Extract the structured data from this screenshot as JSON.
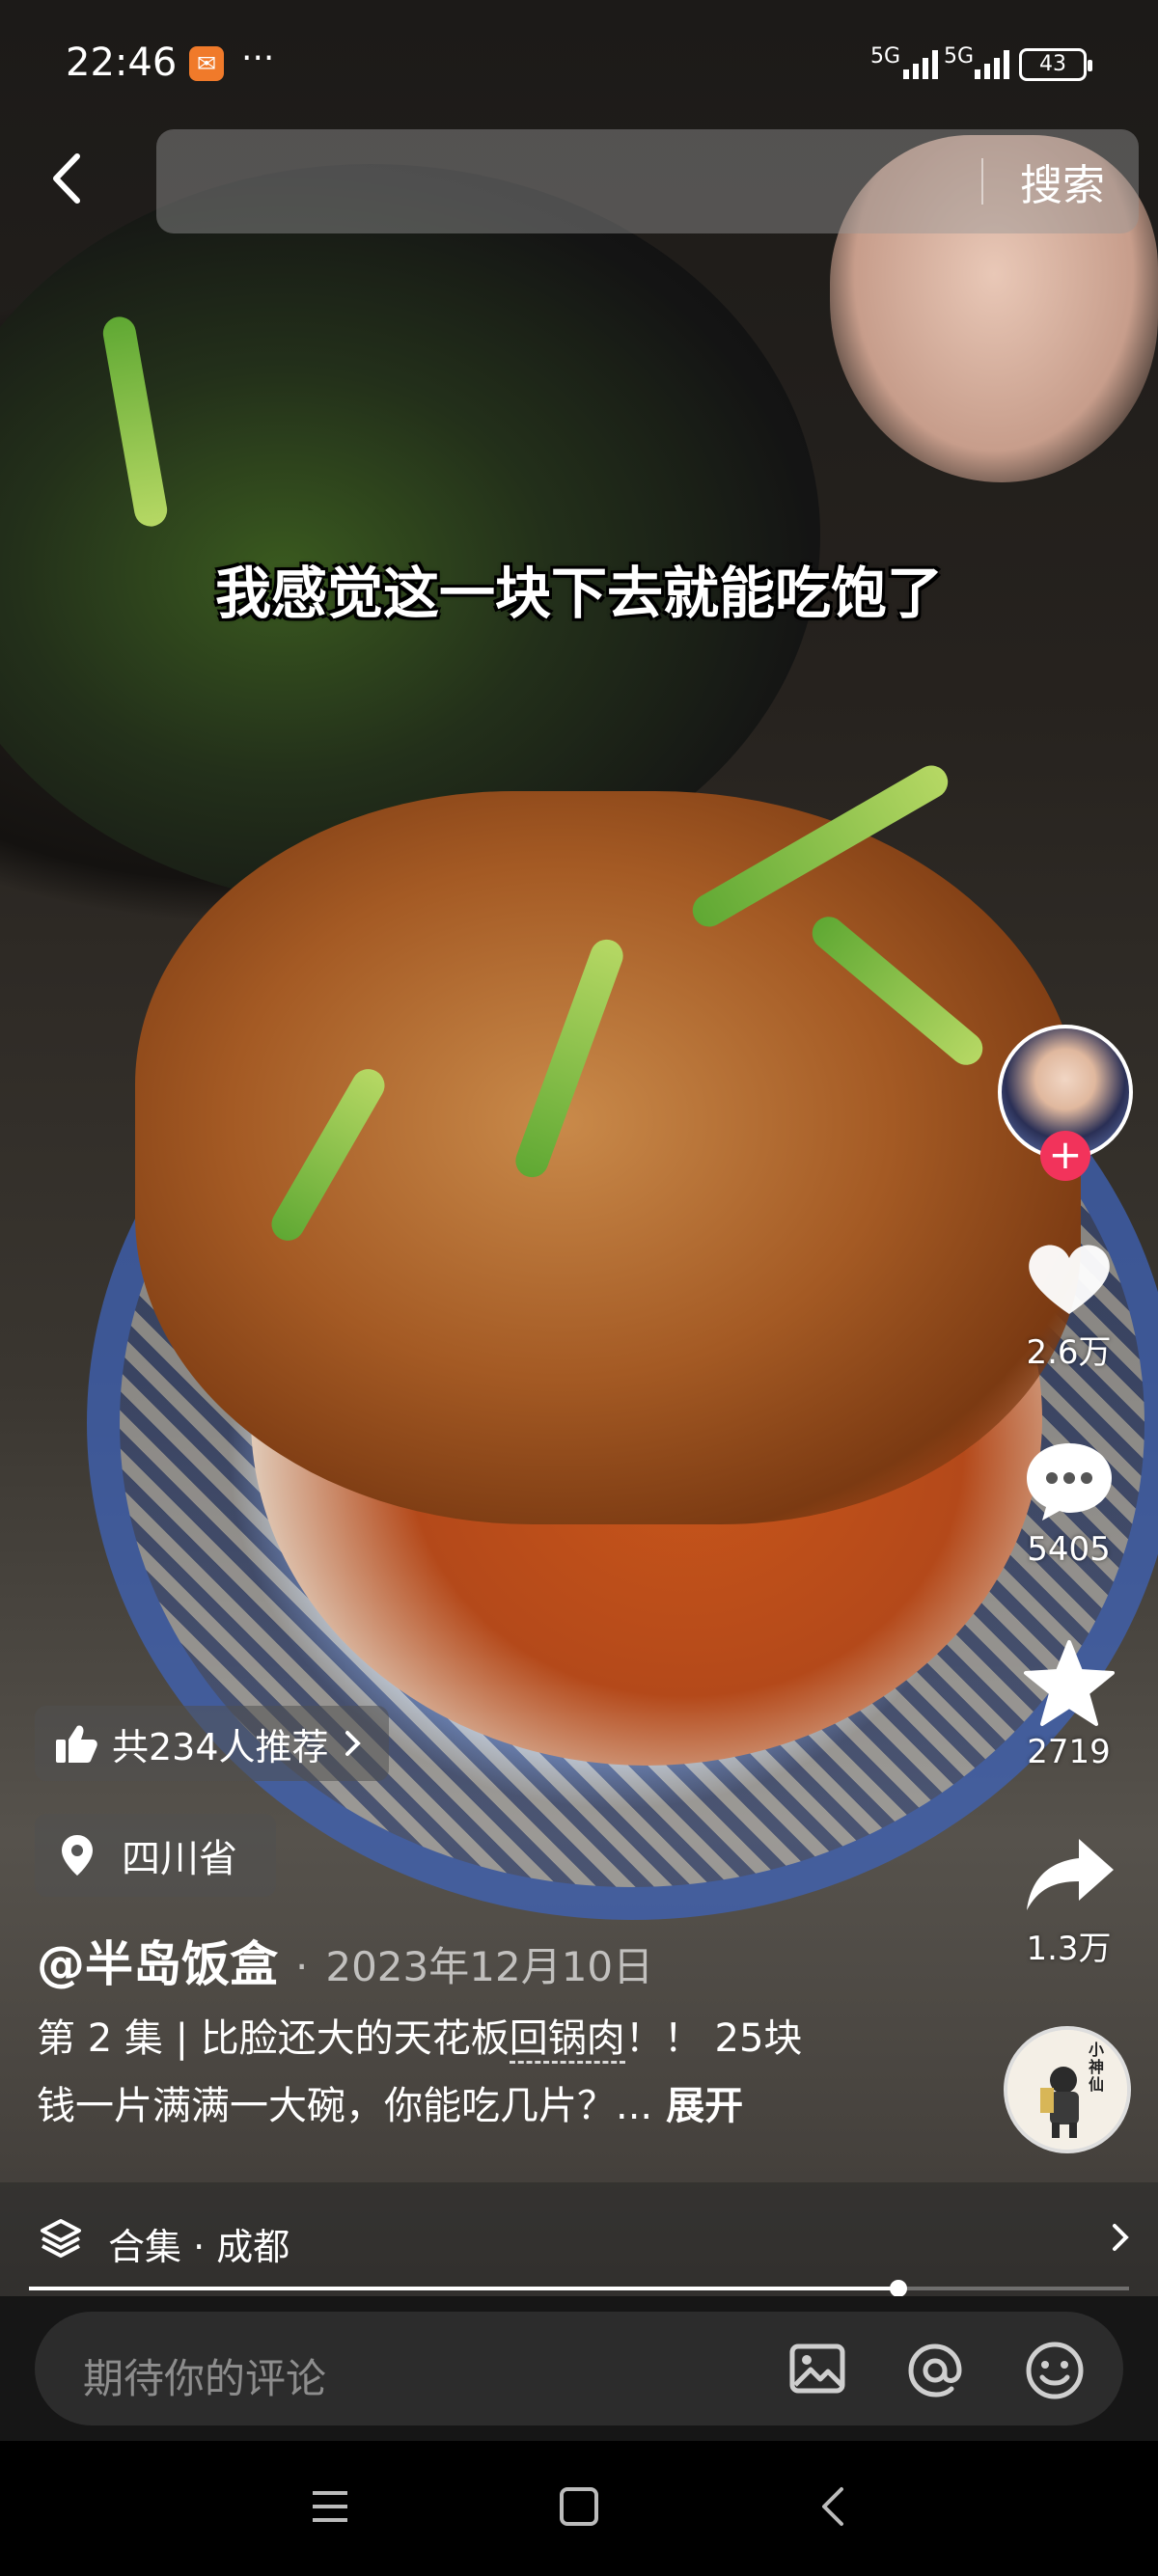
{
  "status_bar": {
    "time": "22:46",
    "more": "···",
    "network_1": "5G",
    "network_2": "5G",
    "battery": "43"
  },
  "search": {
    "button_label": "搜索"
  },
  "video": {
    "caption": "我感觉这一块下去就能吃饱了"
  },
  "actions": {
    "likes": "2.6万",
    "comments": "5405",
    "favorites": "2719",
    "shares": "1.3万",
    "follow_symbol": "+"
  },
  "post": {
    "recommend": "共234人推荐",
    "location": "四川省",
    "author": "@半岛饭盒",
    "date_separator": "·",
    "date": "2023年12月10日",
    "desc_line1_pre": "第 2 集 | 比脸还大的天花板",
    "desc_keyword": "回锅肉",
    "desc_line1_post": "！！ 25块",
    "desc_line2": "钱一片满满一大碗，你能吃几片？...",
    "expand": "展开",
    "collection": "合集 · 成都",
    "progress": 0.79
  },
  "comment": {
    "placeholder": "期待你的评论"
  },
  "music_disc_text": "小神仙",
  "colors": {
    "like_red": "#f2335b",
    "comment_bg": "#2c2c2c"
  }
}
